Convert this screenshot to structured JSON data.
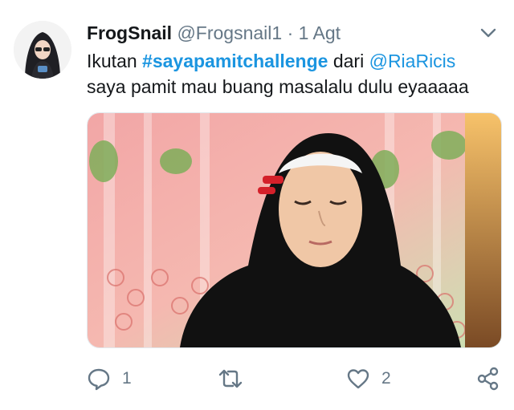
{
  "tweet": {
    "display_name": "FrogSnail",
    "handle": "@Frogsnail1",
    "separator": "·",
    "date": "1 Agt",
    "text_line1_prefix": "Ikutan ",
    "hashtag": "#sayapamitchallenge",
    "text_line1_mid": " dari ",
    "mention": "@RiaRicis",
    "text_line2": "saya pamit mau buang masalalu dulu eyaaaaa"
  },
  "actions": {
    "reply_count": "1",
    "retweet_count": "",
    "like_count": "2"
  },
  "colors": {
    "link": "#1b95e0",
    "secondary": "#657786",
    "text": "#14171a"
  },
  "icons": [
    "avatar",
    "chevron-down-icon",
    "reply-icon",
    "retweet-icon",
    "like-icon",
    "share-icon"
  ]
}
